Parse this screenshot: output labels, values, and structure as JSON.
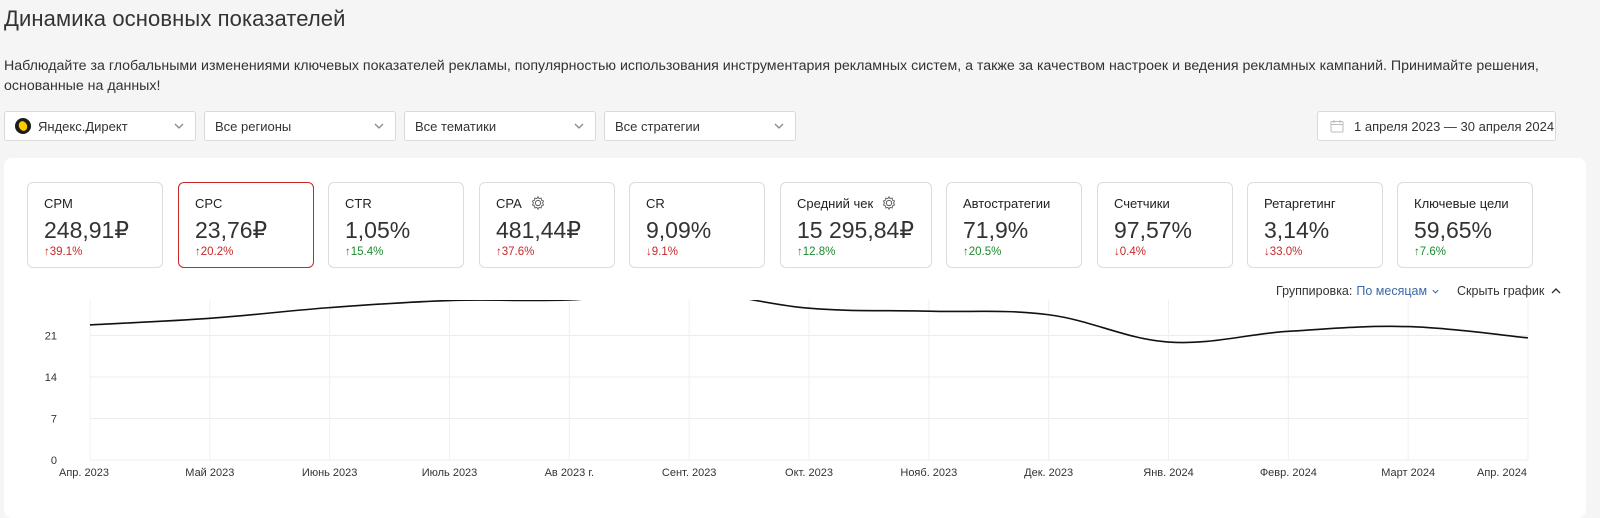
{
  "header": {
    "title": "Динамика основных показателей",
    "description": "Наблюдайте за глобальными изменениями ключевых показателей рекламы, популярностью использования инструментария рекламных систем, а также за качеством настроек и ведения рекламных кампаний. Принимайте решения, основанные на данных!"
  },
  "filters": {
    "system": "Яндекс.Директ",
    "region": "Все регионы",
    "theme": "Все тематики",
    "strategy": "Все стратегии",
    "date_range": "1 апреля 2023 — 30 апреля 2024"
  },
  "metrics": [
    {
      "name": "CPM",
      "value": "248,91₽",
      "delta": "↑39.1%",
      "delta_color": "#c62828",
      "active": false,
      "has_gear": false
    },
    {
      "name": "CPC",
      "value": "23,76₽",
      "delta": "↑20.2%",
      "delta_color": "#c62828",
      "active": true,
      "has_gear": false
    },
    {
      "name": "CTR",
      "value": "1,05%",
      "delta": "↑15.4%",
      "delta_color": "#1b8a2e",
      "active": false,
      "has_gear": false
    },
    {
      "name": "CPA",
      "value": "481,44₽",
      "delta": "↑37.6%",
      "delta_color": "#c62828",
      "active": false,
      "has_gear": true
    },
    {
      "name": "CR",
      "value": "9,09%",
      "delta": "↓9.1%",
      "delta_color": "#c62828",
      "active": false,
      "has_gear": false
    },
    {
      "name": "Средний чек",
      "value": "15 295,84₽",
      "delta": "↑12.8%",
      "delta_color": "#1b8a2e",
      "active": false,
      "has_gear": true
    },
    {
      "name": "Автостратегии",
      "value": "71,9%",
      "delta": "↑20.5%",
      "delta_color": "#1b8a2e",
      "active": false,
      "has_gear": false
    },
    {
      "name": "Счетчики",
      "value": "97,57%",
      "delta": "↓0.4%",
      "delta_color": "#c62828",
      "active": false,
      "has_gear": false
    },
    {
      "name": "Ретаргетинг",
      "value": "3,14%",
      "delta": "↓33.0%",
      "delta_color": "#c62828",
      "active": false,
      "has_gear": false
    },
    {
      "name": "Ключевые цели",
      "value": "59,65%",
      "delta": "↑7.6%",
      "delta_color": "#1b8a2e",
      "active": false,
      "has_gear": false
    }
  ],
  "chart_controls": {
    "grouping_label": "Группировка:",
    "grouping_value": "По месяцам",
    "hide_chart": "Скрыть график"
  },
  "chart_data": {
    "type": "line",
    "categories": [
      "Апр. 2023",
      "Май 2023",
      "Июнь 2023",
      "Июль 2023",
      "Ав 2023 г.",
      "Сент. 2023",
      "Окт. 2023",
      "Нояб. 2023",
      "Дек. 2023",
      "Янв. 2024",
      "Февр. 2024",
      "Март 2024",
      "Апр. 2024"
    ],
    "series": [
      {
        "values": [
          22.8,
          23.9,
          25.7,
          26.9,
          27.0,
          28.4,
          25.6,
          25.1,
          24.5,
          19.9,
          21.7,
          22.5,
          20.6
        ]
      }
    ],
    "ylim": [
      0,
      28
    ],
    "yticks": [
      "0",
      "7",
      "14",
      "21",
      "28"
    ],
    "grid": true,
    "line_color": "#111111"
  }
}
